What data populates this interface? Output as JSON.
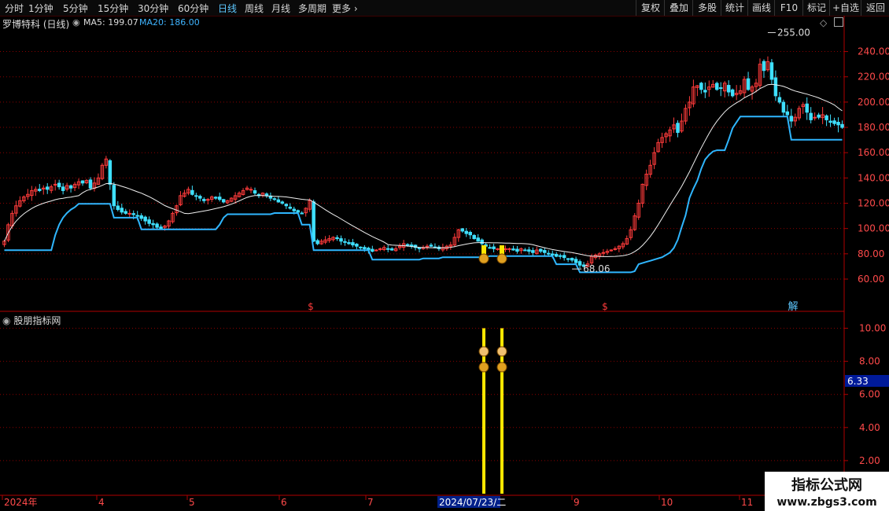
{
  "toolbar": {
    "periods": [
      "分时",
      "1分钟",
      "5分钟",
      "15分钟",
      "30分钟",
      "60分钟",
      "日线",
      "周线",
      "月线",
      "多周期",
      "更多"
    ],
    "active_period": "日线",
    "right_buttons": [
      "复权",
      "叠加",
      "多股",
      "统计",
      "画线",
      "F10",
      "标记",
      "+自选",
      "返回"
    ]
  },
  "stock": {
    "title": "罗博特科 (日线)",
    "ma5": "MA5: 199.07",
    "ma20": "MA20: 186.00"
  },
  "indicator": {
    "title": "股朋指标网",
    "value_badge": "6.33"
  },
  "price_labels": {
    "high": "255.00",
    "low": "68.06"
  },
  "x_axis": {
    "labels": [
      "2024年",
      "4",
      "5",
      "6",
      "7",
      "2024/07/23/二",
      "9",
      "10",
      "11"
    ]
  },
  "markers": {
    "dollar": "$",
    "jie": "解"
  },
  "watermark": {
    "line1": "指标公式网",
    "line2": "www.zbgs3.com"
  },
  "colors": {
    "up": "#ff3b3b",
    "down": "#3fe0ff",
    "ma20": "#3fb4ff",
    "stop": "#2fb6ff",
    "signal": "#ffe600",
    "grid": "#8a0000"
  },
  "chart_data": [
    {
      "type": "candlestick",
      "title": "罗博特科 (日线)",
      "y_axis_ticks": [
        60,
        80,
        100,
        120,
        140,
        160,
        180,
        200,
        220,
        240
      ],
      "ylim": [
        47,
        262
      ],
      "grid": true,
      "annotations": [
        {
          "label": "255.00",
          "value": 255
        },
        {
          "label": "68.06",
          "value": 68.06
        }
      ],
      "close": [
        90,
        103,
        112,
        118,
        122,
        125,
        127,
        130,
        131,
        130,
        132,
        131,
        133,
        135,
        133,
        130,
        134,
        132,
        135,
        137,
        136,
        138,
        132,
        136,
        140,
        150,
        155,
        135,
        118,
        115,
        113,
        112,
        112,
        111,
        110,
        108,
        106,
        104,
        103,
        101,
        100,
        102,
        106,
        112,
        118,
        126,
        128,
        131,
        127,
        126,
        124,
        122,
        123,
        125,
        124,
        123,
        121,
        122,
        124,
        126,
        128,
        130,
        132,
        131,
        128,
        126,
        128,
        126,
        124,
        123,
        121,
        120,
        118,
        116,
        114,
        113,
        112,
        116,
        122,
        90,
        88,
        90,
        91,
        92,
        93,
        92,
        90,
        89,
        88,
        87,
        86,
        85,
        84,
        83,
        82,
        83,
        84,
        85,
        84,
        83,
        84,
        86,
        88,
        87,
        86,
        85,
        84,
        85,
        86,
        86,
        85,
        84,
        85,
        86,
        87,
        93,
        99,
        98,
        96,
        95,
        92,
        90,
        88,
        86,
        85,
        84,
        84,
        83,
        84,
        84,
        83,
        82,
        84,
        83,
        82,
        81,
        83,
        82,
        81,
        80,
        79,
        78,
        78,
        77,
        76,
        75,
        73,
        71,
        70,
        72,
        78,
        79,
        80,
        81,
        82,
        83,
        84,
        86,
        88,
        92,
        99,
        110,
        120,
        135,
        143,
        150,
        160,
        168,
        172,
        175,
        178,
        182,
        176,
        185,
        195,
        200,
        212,
        213,
        210,
        208,
        212,
        214,
        210,
        211,
        215,
        208,
        205,
        207,
        209,
        218,
        210,
        212,
        215,
        230,
        225,
        232,
        218,
        205,
        200,
        192,
        190,
        185,
        188,
        195,
        198,
        192,
        186,
        188,
        188,
        190,
        186,
        184,
        183,
        182,
        180
      ]
    },
    {
      "type": "bar",
      "title": "股朋指标网",
      "y_axis_ticks": [
        2,
        4,
        6,
        8,
        10
      ],
      "ylim": [
        0,
        11
      ],
      "series": [
        {
          "values_at_signal_days": [
            10,
            10
          ]
        }
      ]
    }
  ]
}
